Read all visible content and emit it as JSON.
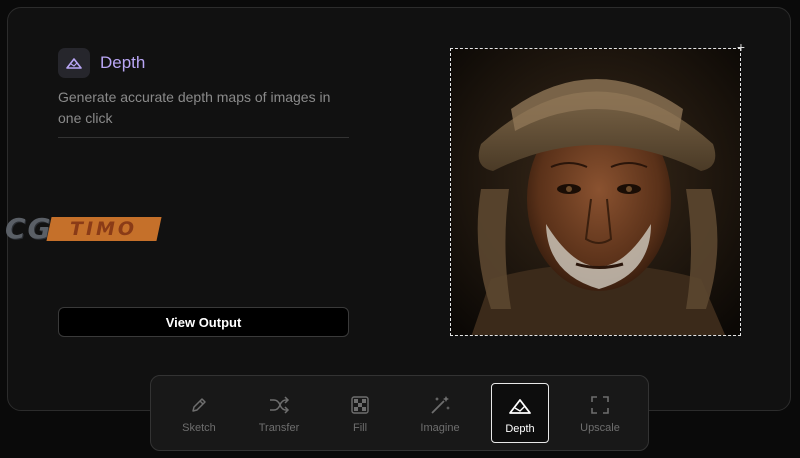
{
  "tool": {
    "title": "Depth",
    "description": "Generate accurate depth maps of images in one click",
    "icon": "mountain-icon",
    "accent": "#b9a6f5"
  },
  "actions": {
    "view_output": "View Output"
  },
  "watermark": {
    "part1": "CG",
    "part2": "TIMO"
  },
  "toolbar": {
    "items": [
      {
        "label": "Sketch",
        "icon": "pencil-icon",
        "active": false
      },
      {
        "label": "Transfer",
        "icon": "shuffle-icon",
        "active": false
      },
      {
        "label": "Fill",
        "icon": "checker-icon",
        "active": false
      },
      {
        "label": "Imagine",
        "icon": "magic-wand-icon",
        "active": false
      },
      {
        "label": "Depth",
        "icon": "mountain-icon",
        "active": true
      },
      {
        "label": "Upscale",
        "icon": "expand-icon",
        "active": false
      }
    ]
  }
}
